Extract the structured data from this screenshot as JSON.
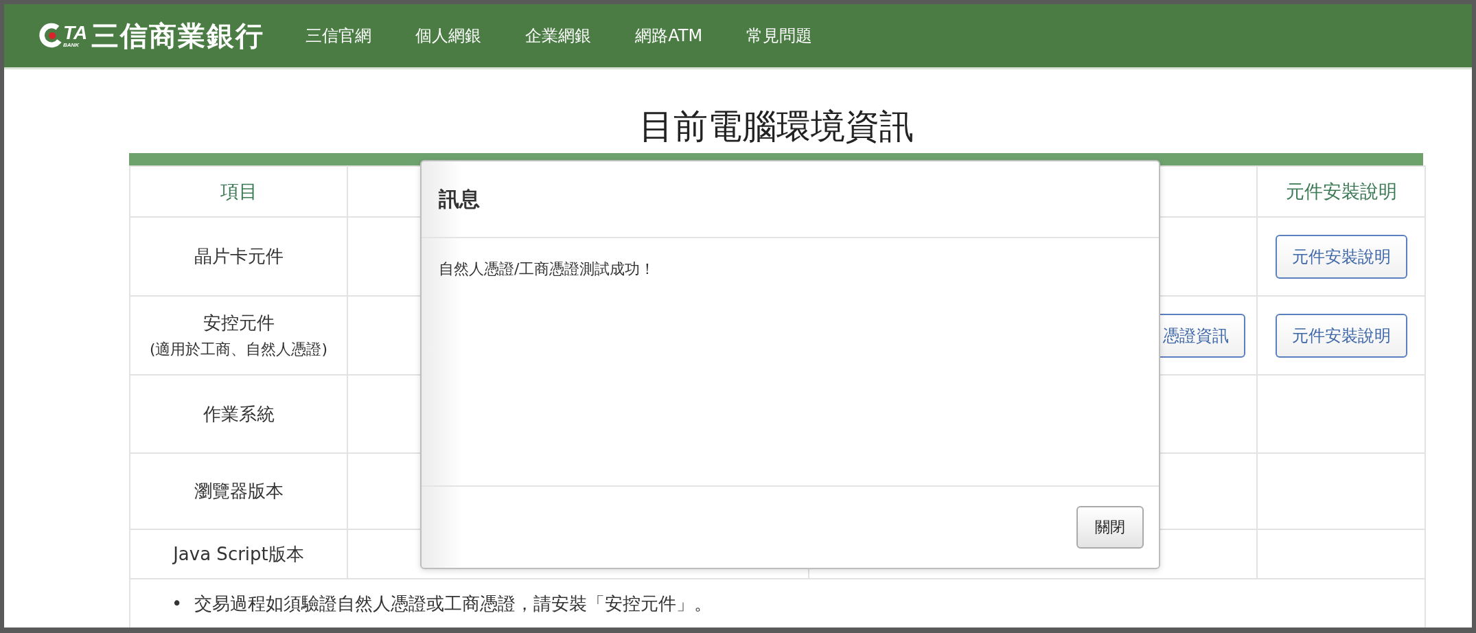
{
  "header": {
    "logo": {
      "mark": "TA",
      "sub": "BANK",
      "name": "三信商業銀行"
    },
    "nav": [
      {
        "label": "三信官網"
      },
      {
        "label": "個人網銀"
      },
      {
        "label": "企業網銀"
      },
      {
        "label": "網路ATM"
      },
      {
        "label": "常見問題"
      }
    ]
  },
  "page_title": "目前電腦環境資訊",
  "table": {
    "first_column": "項目",
    "last_column": "元件安裝說明",
    "rows": [
      {
        "item": "晶片卡元件",
        "guide_button": "元件安裝說明"
      },
      {
        "item": "安控元件",
        "item_note": "(適用於工商、自然人憑證)",
        "cert_button": "憑證資訊",
        "guide_button": "元件安裝說明"
      },
      {
        "item": "作業系統"
      },
      {
        "item": "瀏覽器版本"
      },
      {
        "item": "Java Script版本"
      }
    ],
    "notes": [
      {
        "bullet": "•",
        "text": "交易過程如須驗證自然人憑證或工商憑證，請安裝「安控元件」。"
      }
    ]
  },
  "dialog": {
    "title": "訊息",
    "message": "自然人憑證/工商憑證測試成功！",
    "buttons": [
      {
        "label": "關閉"
      }
    ]
  }
}
